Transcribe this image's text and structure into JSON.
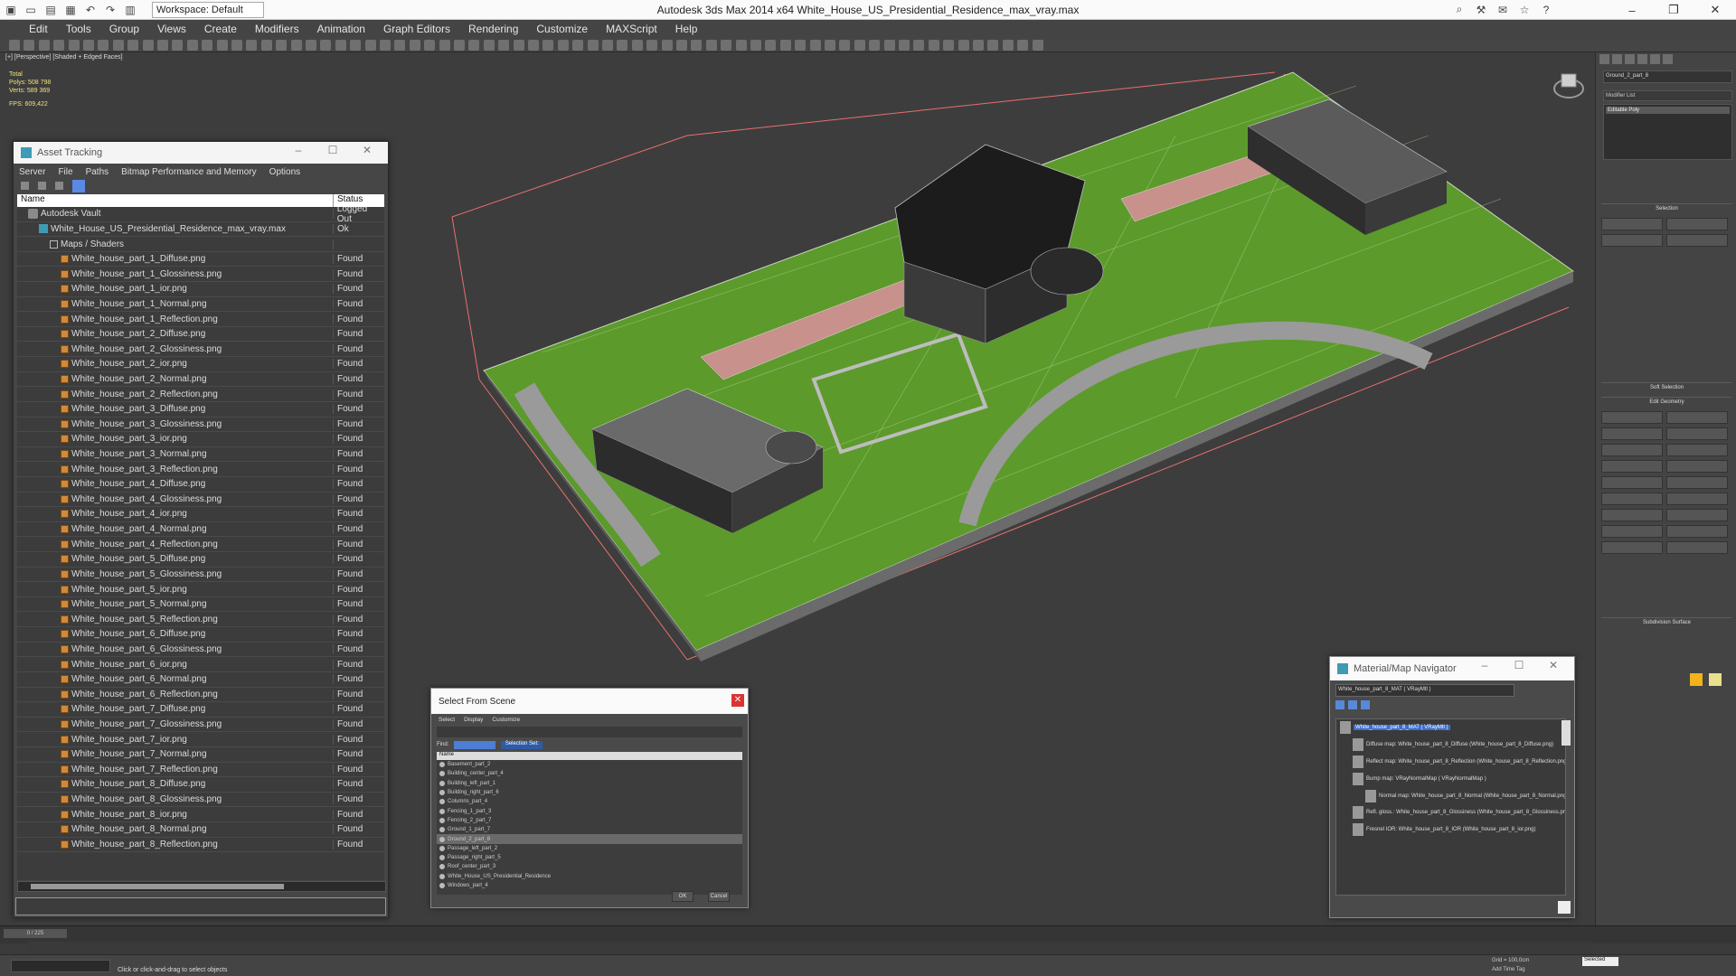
{
  "title_bar": {
    "workspace_label": "Workspace: Default",
    "app_title": "Autodesk 3ds Max  2014 x64     White_House_US_Presidential_Residence_max_vray.max",
    "window_controls": [
      "–",
      "❐",
      "✕"
    ]
  },
  "menu": [
    "Edit",
    "Tools",
    "Group",
    "Views",
    "Create",
    "Modifiers",
    "Animation",
    "Graph Editors",
    "Rendering",
    "Customize",
    "MAXScript",
    "Help"
  ],
  "viewport": {
    "label": "[+] [Perspective] [Shaded + Edged Faces]",
    "stats": {
      "total_label": "Total",
      "polys_label": "Polys:",
      "polys": "508 798",
      "verts_label": "Verts:",
      "verts": "589 369",
      "fps_label": "FPS:",
      "fps": "609,422"
    }
  },
  "asset_tracking": {
    "title": "Asset Tracking",
    "menu": [
      "Server",
      "File",
      "Paths",
      "Bitmap Performance and Memory",
      "Options"
    ],
    "columns": {
      "name": "Name",
      "status": "Status"
    },
    "rows": [
      {
        "name": "Autodesk Vault",
        "status": "Logged Out",
        "type": "vault",
        "indent": 1
      },
      {
        "name": "White_House_US_Presidential_Residence_max_vray.max",
        "status": "Ok",
        "type": "max",
        "indent": 2
      },
      {
        "name": "Maps / Shaders",
        "status": "",
        "type": "folder",
        "indent": 3
      },
      {
        "name": "White_house_part_1_Diffuse.png",
        "status": "Found",
        "type": "file",
        "indent": 4
      },
      {
        "name": "White_house_part_1_Glossiness.png",
        "status": "Found",
        "type": "file",
        "indent": 4
      },
      {
        "name": "White_house_part_1_ior.png",
        "status": "Found",
        "type": "file",
        "indent": 4
      },
      {
        "name": "White_house_part_1_Normal.png",
        "status": "Found",
        "type": "file",
        "indent": 4
      },
      {
        "name": "White_house_part_1_Reflection.png",
        "status": "Found",
        "type": "file",
        "indent": 4
      },
      {
        "name": "White_house_part_2_Diffuse.png",
        "status": "Found",
        "type": "file",
        "indent": 4
      },
      {
        "name": "White_house_part_2_Glossiness.png",
        "status": "Found",
        "type": "file",
        "indent": 4
      },
      {
        "name": "White_house_part_2_ior.png",
        "status": "Found",
        "type": "file",
        "indent": 4
      },
      {
        "name": "White_house_part_2_Normal.png",
        "status": "Found",
        "type": "file",
        "indent": 4
      },
      {
        "name": "White_house_part_2_Reflection.png",
        "status": "Found",
        "type": "file",
        "indent": 4
      },
      {
        "name": "White_house_part_3_Diffuse.png",
        "status": "Found",
        "type": "file",
        "indent": 4
      },
      {
        "name": "White_house_part_3_Glossiness.png",
        "status": "Found",
        "type": "file",
        "indent": 4
      },
      {
        "name": "White_house_part_3_ior.png",
        "status": "Found",
        "type": "file",
        "indent": 4
      },
      {
        "name": "White_house_part_3_Normal.png",
        "status": "Found",
        "type": "file",
        "indent": 4
      },
      {
        "name": "White_house_part_3_Reflection.png",
        "status": "Found",
        "type": "file",
        "indent": 4
      },
      {
        "name": "White_house_part_4_Diffuse.png",
        "status": "Found",
        "type": "file",
        "indent": 4
      },
      {
        "name": "White_house_part_4_Glossiness.png",
        "status": "Found",
        "type": "file",
        "indent": 4
      },
      {
        "name": "White_house_part_4_ior.png",
        "status": "Found",
        "type": "file",
        "indent": 4
      },
      {
        "name": "White_house_part_4_Normal.png",
        "status": "Found",
        "type": "file",
        "indent": 4
      },
      {
        "name": "White_house_part_4_Reflection.png",
        "status": "Found",
        "type": "file",
        "indent": 4
      },
      {
        "name": "White_house_part_5_Diffuse.png",
        "status": "Found",
        "type": "file",
        "indent": 4
      },
      {
        "name": "White_house_part_5_Glossiness.png",
        "status": "Found",
        "type": "file",
        "indent": 4
      },
      {
        "name": "White_house_part_5_ior.png",
        "status": "Found",
        "type": "file",
        "indent": 4
      },
      {
        "name": "White_house_part_5_Normal.png",
        "status": "Found",
        "type": "file",
        "indent": 4
      },
      {
        "name": "White_house_part_5_Reflection.png",
        "status": "Found",
        "type": "file",
        "indent": 4
      },
      {
        "name": "White_house_part_6_Diffuse.png",
        "status": "Found",
        "type": "file",
        "indent": 4
      },
      {
        "name": "White_house_part_6_Glossiness.png",
        "status": "Found",
        "type": "file",
        "indent": 4
      },
      {
        "name": "White_house_part_6_ior.png",
        "status": "Found",
        "type": "file",
        "indent": 4
      },
      {
        "name": "White_house_part_6_Normal.png",
        "status": "Found",
        "type": "file",
        "indent": 4
      },
      {
        "name": "White_house_part_6_Reflection.png",
        "status": "Found",
        "type": "file",
        "indent": 4
      },
      {
        "name": "White_house_part_7_Diffuse.png",
        "status": "Found",
        "type": "file",
        "indent": 4
      },
      {
        "name": "White_house_part_7_Glossiness.png",
        "status": "Found",
        "type": "file",
        "indent": 4
      },
      {
        "name": "White_house_part_7_ior.png",
        "status": "Found",
        "type": "file",
        "indent": 4
      },
      {
        "name": "White_house_part_7_Normal.png",
        "status": "Found",
        "type": "file",
        "indent": 4
      },
      {
        "name": "White_house_part_7_Reflection.png",
        "status": "Found",
        "type": "file",
        "indent": 4
      },
      {
        "name": "White_house_part_8_Diffuse.png",
        "status": "Found",
        "type": "file",
        "indent": 4
      },
      {
        "name": "White_house_part_8_Glossiness.png",
        "status": "Found",
        "type": "file",
        "indent": 4
      },
      {
        "name": "White_house_part_8_ior.png",
        "status": "Found",
        "type": "file",
        "indent": 4
      },
      {
        "name": "White_house_part_8_Normal.png",
        "status": "Found",
        "type": "file",
        "indent": 4
      },
      {
        "name": "White_house_part_8_Reflection.png",
        "status": "Found",
        "type": "file",
        "indent": 4
      }
    ]
  },
  "select_from_scene": {
    "title": "Select From Scene",
    "menu": [
      "Select",
      "Display",
      "Customize"
    ],
    "find_label": "Find:",
    "selection_set_label": "Selection Set:",
    "column": "Name",
    "items": [
      "Basement_part_2",
      "Building_center_part_4",
      "Building_left_part_1",
      "Building_right_part_6",
      "Columns_part_4",
      "Fencing_1_part_3",
      "Fencing_2_part_7",
      "Ground_1_part_7",
      "Ground_2_part_8",
      "Passage_left_part_2",
      "Passage_right_part_5",
      "Roof_center_part_3",
      "White_House_US_Presidential_Residence",
      "Windows_part_4"
    ],
    "highlighted_index": 8,
    "ok": "OK",
    "cancel": "Cancel"
  },
  "material_navigator": {
    "title": "Material/Map Navigator",
    "material_name": "White_house_part_8_MAT  ( VRayMtl )",
    "nodes": [
      "White_house_part_8_MAT  ( VRayMtl )",
      "Diffuse map: White_house_part_8_Diffuse (White_house_part_8_Diffuse.png)",
      "Reflect map: White_house_part_8_Reflection (White_house_part_8_Reflection.png)",
      "Bump map: VRayNormalMap  ( VRayNormalMap )",
      "Normal map: White_house_part_8_Normal (White_house_part_8_Normal.png)",
      "Refl. gloss.: White_house_part_8_Glossiness (White_house_part_8_Glossiness.png)",
      "Fresnel IOR: White_house_part_8_IOR (White_house_part_8_ior.png)"
    ]
  },
  "command_panel": {
    "object_name": "Ground_2_part_8",
    "modifier_list": "Modifier List",
    "stack_item": "Editable Poly",
    "rollouts": [
      "Selection",
      "Soft Selection",
      "Edit Geometry",
      "Subdivision Surface"
    ],
    "swatch_colors": [
      "#f2b21a",
      "#e8e08a"
    ]
  },
  "status": {
    "timeslider": "0 / 225",
    "prompt": "Click or click-and-drag to select objects",
    "selected": "Selected",
    "grid": "Grid = 100,0cm",
    "add_time_tag": "Add Time Tag"
  },
  "colors": {
    "accent": "#3a6fd2",
    "grass": "#5c9a2c",
    "terrace": "#c8918b",
    "frame": "#e8706d"
  }
}
